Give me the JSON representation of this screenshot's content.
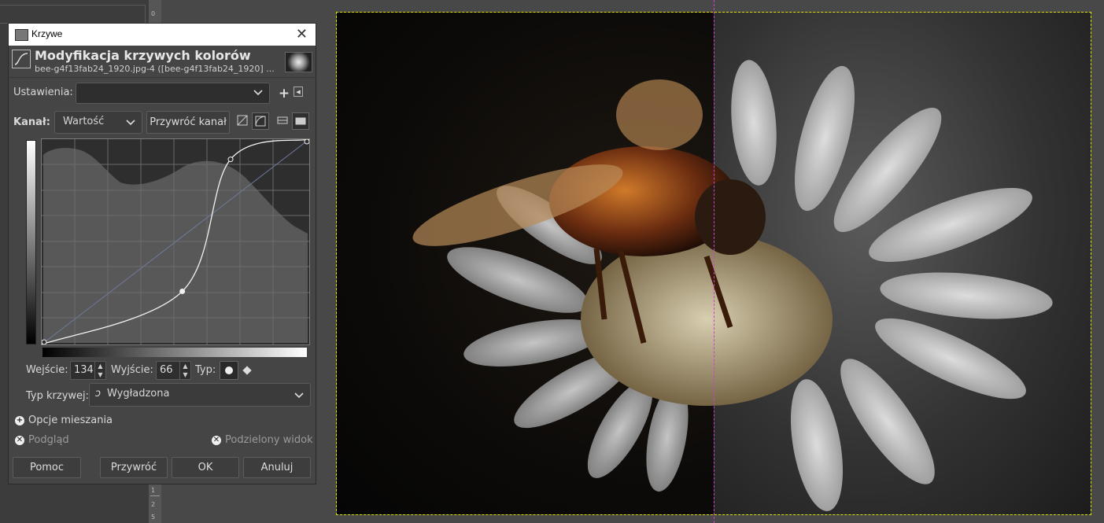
{
  "canvas_ruler": {
    "numbers": [
      "0",
      "1",
      "2",
      "5"
    ]
  },
  "dialog": {
    "window_title": "Krzywe",
    "close_glyph": "✕",
    "header": {
      "title": "Modyfikacja krzywych kolorów",
      "subtitle": "bee-g4f13fab24_1920.jpg-4 ([bee-g4f13fab24_1920] ..."
    },
    "presets": {
      "label": "Ustawienia:",
      "value": "",
      "add_glyph": "+",
      "menu_glyph": "◂"
    },
    "channel": {
      "label": "Kanał:",
      "value": "Wartość",
      "reset_label": "Przywróć kanał"
    },
    "curve": {
      "input_label": "Wejście:",
      "input_value": "134",
      "output_label": "Wyjście:",
      "output_value": "66",
      "type_label": "Typ:",
      "curve_type_label": "Typ krzywej:",
      "curve_type_value": "Wygładzona",
      "points": [
        [
          0,
          0
        ],
        [
          134,
          66
        ],
        [
          180,
          230
        ],
        [
          255,
          255
        ]
      ]
    },
    "blending_options": "Opcje mieszania",
    "preview_label": "Podgląd",
    "split_view_label": "Podzielony widok",
    "buttons": {
      "help": "Pomoc",
      "reset": "Przywróć",
      "ok": "OK",
      "cancel": "Anuluj"
    }
  },
  "colors": {
    "selection_border": "#e0e000",
    "split_guide": "#d040d0",
    "dialog_bg": "#454545"
  }
}
